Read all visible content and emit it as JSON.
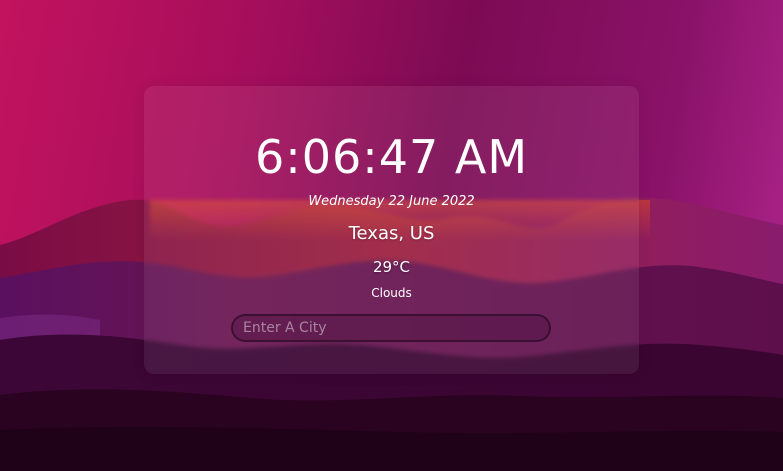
{
  "clock": {
    "time": "6:06:47 AM",
    "date": "Wednesday 22 June 2022"
  },
  "weather": {
    "location": "Texas, US",
    "temperature": "29°C",
    "condition": "Clouds"
  },
  "search": {
    "placeholder": "Enter A City",
    "value": ""
  },
  "colors": {
    "background_left": "#c2135e",
    "background_right": "#b1268f",
    "mountain_dark": "#2a0320",
    "text": "#ffffff"
  }
}
